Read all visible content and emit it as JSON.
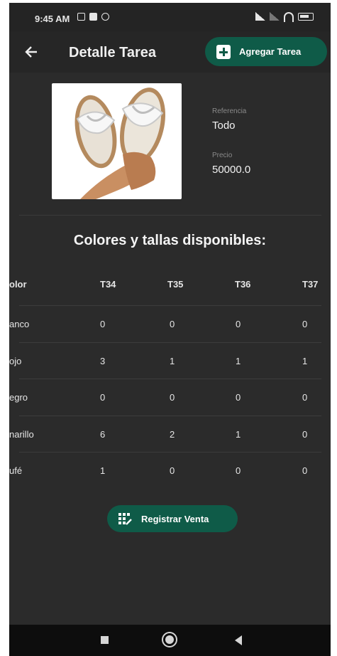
{
  "status": {
    "time": "9:45 AM"
  },
  "header": {
    "title": "Detalle Tarea",
    "add_button": "Agregar Tarea"
  },
  "product": {
    "reference_label": "Referencia",
    "reference_value": "Todo",
    "price_label": "Precio",
    "price_value": "50000.0"
  },
  "section_title": "Colores y tallas disponibles:",
  "table": {
    "headers": [
      "olor",
      "T34",
      "T35",
      "T36",
      "T37"
    ],
    "rows": [
      [
        "anco",
        "0",
        "0",
        "0",
        "0"
      ],
      [
        "ojo",
        "3",
        "1",
        "1",
        "1"
      ],
      [
        "egro",
        "0",
        "0",
        "0",
        "0"
      ],
      [
        "narillo",
        "6",
        "2",
        "1",
        "0"
      ],
      [
        "ufé",
        "1",
        "0",
        "0",
        "0"
      ]
    ]
  },
  "register_button": "Registrar Venta",
  "colors": {
    "background": "#2b2b2b",
    "accent": "#0f5b48"
  }
}
